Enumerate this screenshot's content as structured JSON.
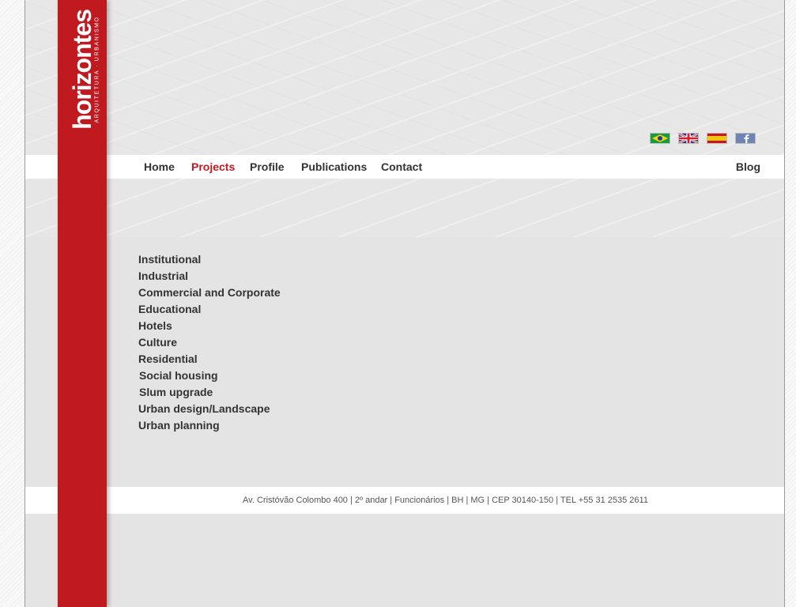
{
  "brand": {
    "logo_text": "horizontes",
    "tagline": "ARQUITETURA · URBANISMO",
    "color": "#c0191f"
  },
  "languages": [
    {
      "name": "Português",
      "icon": "brazil-flag-icon"
    },
    {
      "name": "English",
      "icon": "uk-flag-icon"
    },
    {
      "name": "Español",
      "icon": "spain-flag-icon"
    },
    {
      "name": "Facebook",
      "icon": "facebook-icon"
    }
  ],
  "nav": {
    "items": [
      {
        "label": "Home",
        "active": false
      },
      {
        "label": "Projects",
        "active": true
      },
      {
        "label": "Profile",
        "active": false
      },
      {
        "label": "Publications",
        "active": false
      },
      {
        "label": "Contact",
        "active": false
      }
    ],
    "blog": "Blog"
  },
  "categories": [
    "Institutional",
    "Industrial",
    "Commercial and Corporate",
    "Educational",
    "Hotels",
    "Culture",
    "Residential",
    "Social housing",
    "Slum upgrade",
    "Urban design/Landscape",
    "Urban planning"
  ],
  "footer": {
    "address": "Av. Cristóvão Colombo 400 | 2º andar | Funcionários | BH | MG | CEP 30140-150 | TEL +55 31 2535 2611"
  },
  "colors": {
    "accent": "#c0191f",
    "text": "#333333"
  }
}
